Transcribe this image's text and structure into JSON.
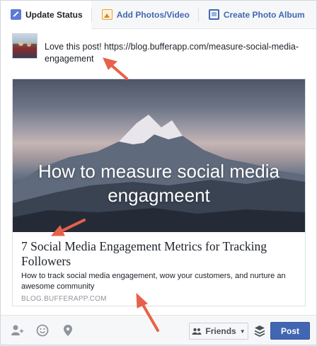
{
  "tabs": [
    {
      "label": "Update Status",
      "icon": "pencil-icon",
      "active": true
    },
    {
      "label": "Add Photos/Video",
      "icon": "photo-icon",
      "active": false
    },
    {
      "label": "Create Photo Album",
      "icon": "album-icon",
      "active": false
    }
  ],
  "status": {
    "text": "Love this post! https://blog.bufferapp.com/measure-social-media-engagement"
  },
  "link_preview": {
    "image_text": "How to measure social media engagmeent",
    "title": "7 Social Media Engagement Metrics for Tracking Followers",
    "description": "How to track social media engagement, wow your customers, and nurture an awesome community",
    "domain": "BLOG.BUFFERAPP.COM"
  },
  "footer": {
    "icons": [
      "tag-friends-icon",
      "feeling-icon",
      "location-pin-icon"
    ],
    "audience_label": "Friends",
    "post_label": "Post"
  },
  "colors": {
    "brand": "#4267b2",
    "annotation_arrow": "#e8614a"
  }
}
